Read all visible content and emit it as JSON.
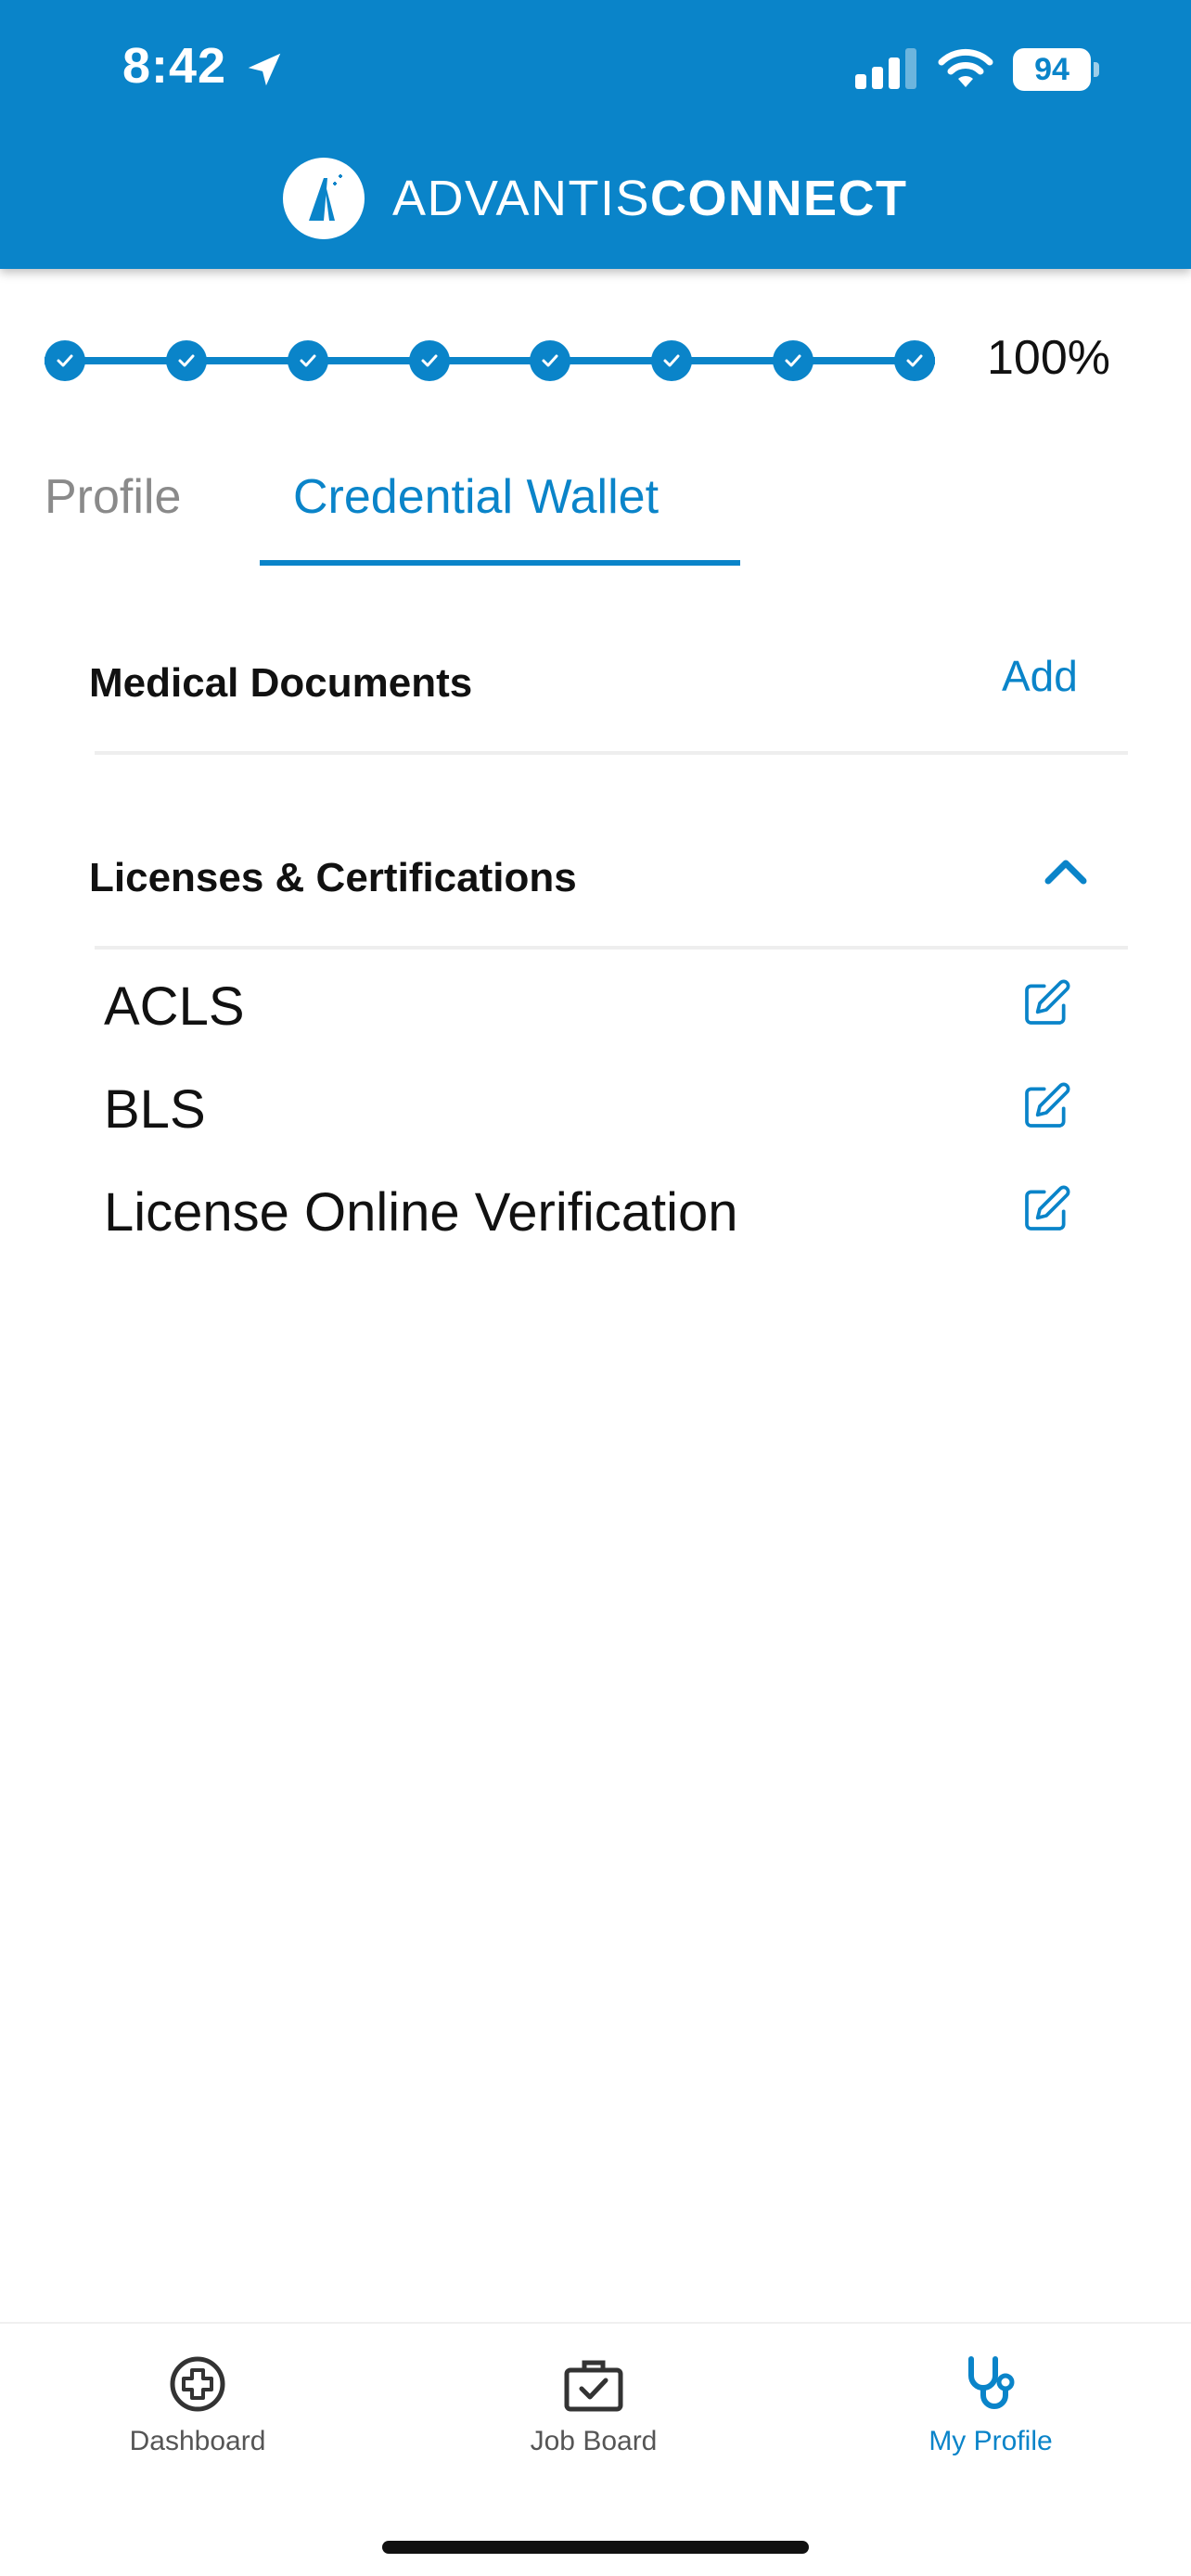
{
  "status_bar": {
    "time": "8:42",
    "battery": "94"
  },
  "app": {
    "brand_light": "ADVANTIS",
    "brand_bold": "CONNECT"
  },
  "progress": {
    "steps_completed": 8,
    "steps_total": 8,
    "percent_label": "100%"
  },
  "tabs": [
    {
      "label": "Profile",
      "active": false
    },
    {
      "label": "Credential Wallet",
      "active": true
    }
  ],
  "sections": {
    "medical": {
      "title": "Medical Documents",
      "action": "Add"
    },
    "licenses": {
      "title": "Licenses & Certifications",
      "expanded": true,
      "items": [
        "ACLS",
        "BLS",
        "License Online Verification"
      ]
    }
  },
  "bottom_nav": [
    {
      "label": "Dashboard",
      "icon": "medical-cross-icon",
      "active": false
    },
    {
      "label": "Job Board",
      "icon": "briefcase-check-icon",
      "active": false
    },
    {
      "label": "My Profile",
      "icon": "stethoscope-icon",
      "active": true
    }
  ],
  "colors": {
    "primary": "#0a84c9",
    "text": "#111111",
    "muted": "#8a8a8a"
  }
}
